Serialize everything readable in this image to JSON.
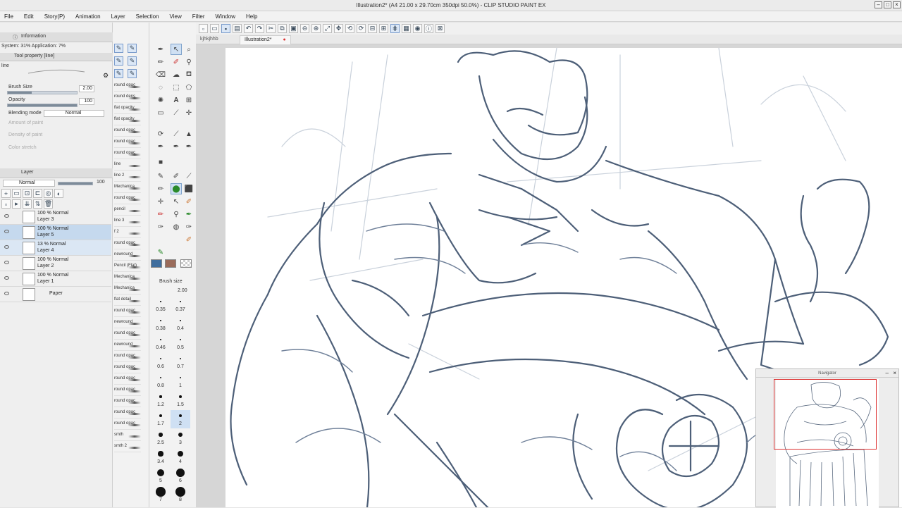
{
  "window": {
    "title": "Illustration2* (A4 21.00 x 29.70cm 350dpi 50.0%) - CLIP STUDIO PAINT EX"
  },
  "menu": [
    "File",
    "Edit",
    "Story(P)",
    "Animation",
    "Layer",
    "Selection",
    "View",
    "Filter",
    "Window",
    "Help"
  ],
  "doc_tabs": [
    "kjhkjhhb",
    "Illustration2*"
  ],
  "left_panel": {
    "tabs": {
      "info": "Information",
      "sub": "Sub",
      "tool": "Tool"
    },
    "system_info": "System: 31% Application:",
    "system_pct": "7%",
    "tool_property_title": "Tool property [line]",
    "tool_name": "line",
    "brush_size_label": "Brush Size",
    "brush_size_value": "2.00",
    "brush_size_fraction": 0.35,
    "opacity_label": "Opacity",
    "opacity_value": "100",
    "opacity_fraction": 1.0,
    "blending_label": "Blending mode",
    "blending_value": "Normal",
    "amount_label": "Amount of paint",
    "density_label": "Density of paint",
    "color_stretch_label": "Color stretch",
    "layer_tab": "Layer",
    "layer_blend": "Normal",
    "layer_opacity": "100",
    "layers": [
      {
        "mode": "100 % Normal",
        "name": "Layer 3",
        "state": "normal"
      },
      {
        "mode": "100 % Normal",
        "name": "Layer 5",
        "state": "selected"
      },
      {
        "mode": "13 % Normal",
        "name": "Layer 4",
        "state": "highlight"
      },
      {
        "mode": "100 % Normal",
        "name": "Layer 2",
        "state": "normal"
      },
      {
        "mode": "100 % Normal",
        "name": "Layer 1",
        "state": "normal"
      },
      {
        "mode": "",
        "name": "Paper",
        "state": "normal"
      }
    ]
  },
  "subtools": [
    "round opac",
    "round dens",
    "flat opacity",
    "flat opacity",
    "round opac",
    "round opac",
    "round opac",
    "line",
    "line 2",
    "Mechanica",
    "round opac",
    "pencil",
    "line 3",
    "f 2",
    "round opac",
    "newround",
    "Pencil (Flat)",
    "Mechanica",
    "Mechanica",
    "flat detail",
    "round opac",
    "newround",
    "round opac",
    "newround",
    "round opac",
    "round opac",
    "round opac",
    "round opac",
    "round opac",
    "round opac",
    "round opac",
    "smth",
    "smth 2"
  ],
  "brush_size_panel": {
    "title": "Brush size",
    "current": "2.00",
    "sizes": [
      "0.35",
      "0.37",
      "0.38",
      "0.4",
      "0.46",
      "0.5",
      "0.6",
      "0.7",
      "0.8",
      "1",
      "1.2",
      "1.5",
      "1.7",
      "2",
      "2.5",
      "3",
      "3.4",
      "4",
      "5",
      "6",
      "7",
      "8"
    ]
  },
  "navigator": {
    "title": "Navigator"
  },
  "colors": {
    "accent": "#2f6fc4",
    "line_art": "#43546a",
    "navigator_frame": "#dd3333",
    "main_color": "#3f6e9e",
    "sub_color": "#9a6b5a"
  }
}
